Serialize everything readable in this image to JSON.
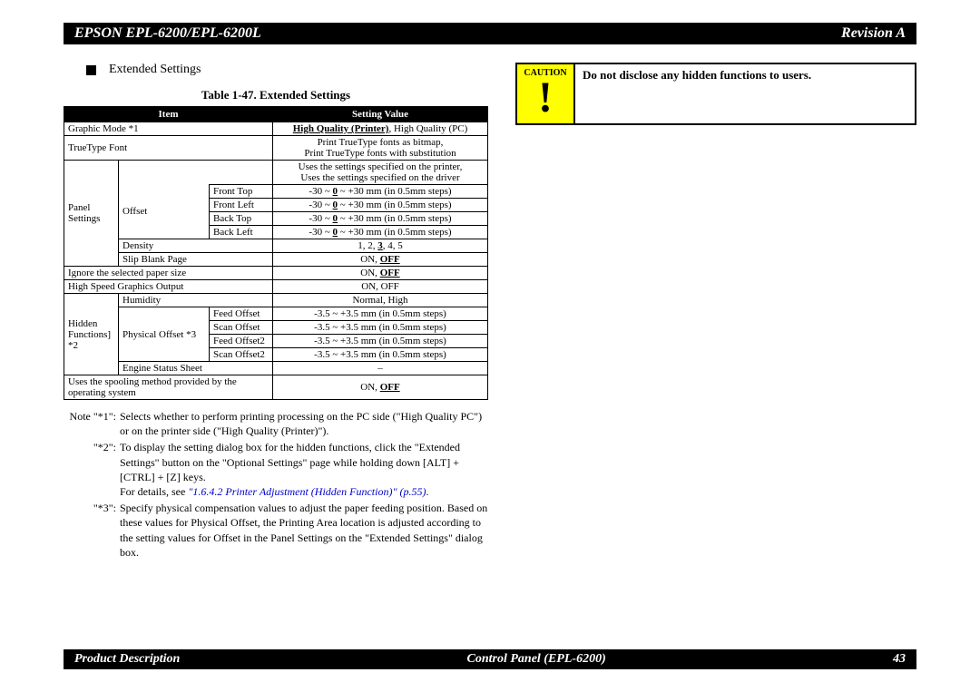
{
  "header": {
    "title": "EPSON EPL-6200/EPL-6200L",
    "revision": "Revision A"
  },
  "section_heading": "Extended Settings",
  "table": {
    "caption": "Table 1-47.  Extended Settings",
    "headers": {
      "item": "Item",
      "value": "Setting Value"
    },
    "row_graphic_mode": {
      "item": "Graphic Mode *1",
      "value_hq_printer": "High Quality (Printer)",
      "value_rest": ", High Quality (PC)"
    },
    "row_truetype": {
      "item": "TrueType Font",
      "value1": "Print TrueType fonts as bitmap,",
      "value2": "Print TrueType fonts with substitution"
    },
    "panel_settings": {
      "label": "Panel Settings",
      "uses1": "Uses the settings specified on the printer,",
      "uses2": "Uses the settings specified on the driver",
      "offset_label": "Offset",
      "offset_rows": {
        "ft": {
          "label": "Front Top",
          "value_a": "-30 ~ ",
          "value_b": "0",
          "value_c": " ~ +30 mm (in 0.5mm steps)"
        },
        "fl": {
          "label": "Front Left",
          "value_a": "-30 ~ ",
          "value_b": "0",
          "value_c": " ~ +30 mm (in 0.5mm steps)"
        },
        "bt": {
          "label": "Back Top",
          "value_a": "-30 ~ ",
          "value_b": "0",
          "value_c": " ~ +30 mm (in 0.5mm steps)"
        },
        "bl": {
          "label": "Back Left",
          "value_a": "-30 ~ ",
          "value_b": "0",
          "value_c": " ~ +30 mm (in 0.5mm steps)"
        }
      },
      "density": {
        "label": "Density",
        "a": "1, 2, ",
        "b": "3",
        "c": ", 4, 5"
      },
      "slip": {
        "label": "Slip Blank Page",
        "a": "ON, ",
        "b": "OFF"
      },
      "ignore": {
        "label": "Ignore the selected paper size",
        "a": "ON, ",
        "b": "OFF"
      }
    },
    "hs_graphics": {
      "label": "High Speed Graphics Output",
      "value": "ON, OFF"
    },
    "hidden": {
      "label1": "Hidden",
      "label2": "Functions] *2",
      "humidity": {
        "label": "Humidity",
        "value": "Normal, High"
      },
      "po_label": "Physical Offset *3",
      "po_rows": {
        "fo": {
          "label": "Feed Offset",
          "value": "-3.5 ~ +3.5 mm (in 0.5mm steps)"
        },
        "so": {
          "label": "Scan Offset",
          "value": "-3.5 ~ +3.5 mm (in 0.5mm steps)"
        },
        "fo2": {
          "label": "Feed Offset2",
          "value": "-3.5 ~ +3.5 mm (in 0.5mm steps)"
        },
        "so2": {
          "label": "Scan Offset2",
          "value": "-3.5 ~ +3.5 mm (in 0.5mm steps)"
        }
      },
      "engine": {
        "label": "Engine Status Sheet",
        "value": "–"
      }
    },
    "spooling": {
      "label": "Uses the spooling method provided by the operating system",
      "a": "ON, ",
      "b": "OFF"
    }
  },
  "notes": {
    "n1_label": "Note \"*1\":",
    "n1": "Selects whether to perform printing processing on the PC side (\"High Quality PC\") or on the printer side (\"High Quality (Printer)\").",
    "n2_label": "\"*2\":",
    "n2a": "To display the setting dialog box for the hidden functions, click the \"Extended Settings\" button on the \"Optional Settings\" page while holding down [ALT] + [CTRL] + [Z] keys.",
    "n2b_a": "For details, see ",
    "n2b_link": "\"1.6.4.2 Printer Adjustment (Hidden Function)\" (p.55)",
    "n2b_c": ".",
    "n3_label": "\"*3\":",
    "n3": "Specify physical compensation values to adjust the paper feeding position. Based on these values for Physical Offset, the Printing Area location is adjusted according to the setting values for Offset in the Panel Settings on the \"Extended Settings\" dialog box."
  },
  "caution": {
    "label": "CAUTION",
    "icon": "!",
    "text": "Do not disclose any hidden functions to users."
  },
  "footer": {
    "left": "Product Description",
    "center": "Control Panel (EPL-6200)",
    "page": "43"
  }
}
